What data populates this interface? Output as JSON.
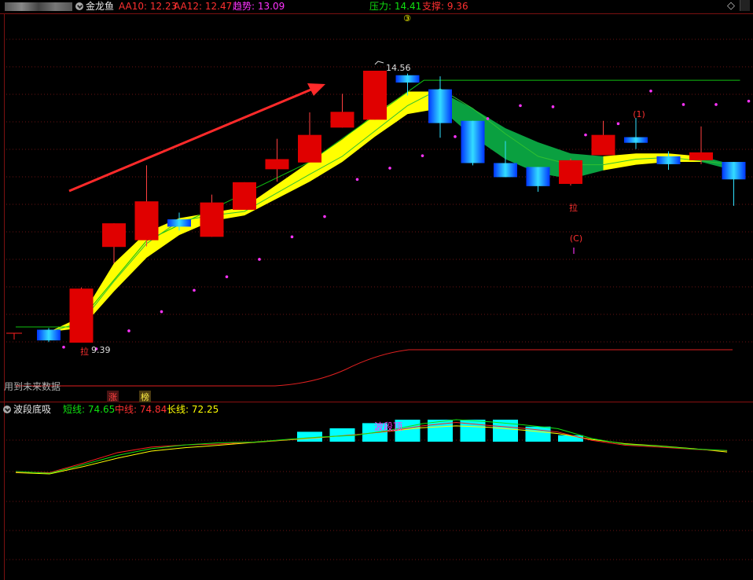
{
  "main_header": {
    "indicator_name": "金龙鱼",
    "aa10": "AA10: 12.23",
    "aa12": "AA12: 12.47",
    "trend": "趋势: 13.09",
    "pressure": "压力: 14.41",
    "support": "支撑: 9.36",
    "diamond_icon": "diamond-icon"
  },
  "main_chart": {
    "marker_top": "③",
    "high_label": "14.56",
    "low_label": "9.39",
    "pull_label_1": "拉",
    "pull_label_2": "拉",
    "wave_1": "(1)",
    "wave_c": "(C)",
    "wave_i": "I",
    "future_note": "用到未来数据",
    "tag_zhang": "涨",
    "tag_bang": "榜",
    "candles": [
      {
        "o": 10.02,
        "c": 9.83,
        "h": 10.05,
        "l": 9.8,
        "s": "blue"
      },
      {
        "o": 9.79,
        "c": 10.75,
        "h": 10.77,
        "l": 9.79,
        "s": "red"
      },
      {
        "o": 11.49,
        "c": 11.91,
        "h": 11.91,
        "l": 11.2,
        "s": "red"
      },
      {
        "o": 11.61,
        "c": 12.3,
        "h": 12.94,
        "l": 11.5,
        "s": "red"
      },
      {
        "o": 11.98,
        "c": 11.85,
        "h": 12.1,
        "l": 11.78,
        "s": "blue"
      },
      {
        "o": 11.67,
        "c": 12.28,
        "h": 12.42,
        "l": 11.67,
        "s": "red"
      },
      {
        "o": 12.15,
        "c": 12.64,
        "h": 12.64,
        "l": 12.15,
        "s": "red"
      },
      {
        "o": 12.87,
        "c": 13.05,
        "h": 13.41,
        "l": 12.65,
        "s": "red"
      },
      {
        "o": 12.99,
        "c": 13.48,
        "h": 13.88,
        "l": 12.99,
        "s": "red"
      },
      {
        "o": 13.61,
        "c": 13.89,
        "h": 14.21,
        "l": 13.61,
        "s": "red"
      },
      {
        "o": 13.75,
        "c": 14.62,
        "h": 14.62,
        "l": 13.75,
        "s": "red"
      },
      {
        "o": 14.54,
        "c": 14.41,
        "h": 14.57,
        "l": 14.18,
        "s": "blue"
      },
      {
        "o": 14.29,
        "c": 13.69,
        "h": 14.52,
        "l": 13.43,
        "s": "blue"
      },
      {
        "o": 13.73,
        "c": 12.98,
        "h": 13.73,
        "l": 12.94,
        "s": "blue"
      },
      {
        "o": 12.98,
        "c": 12.73,
        "h": 13.37,
        "l": 12.73,
        "s": "blue"
      },
      {
        "o": 12.91,
        "c": 12.57,
        "h": 12.91,
        "l": 12.47,
        "s": "blue"
      },
      {
        "o": 12.61,
        "c": 13.03,
        "h": 13.06,
        "l": 12.58,
        "s": "red"
      },
      {
        "o": 13.12,
        "c": 13.48,
        "h": 13.73,
        "l": 13.12,
        "s": "red"
      },
      {
        "o": 13.44,
        "c": 13.34,
        "h": 13.78,
        "l": 13.23,
        "s": "blue"
      },
      {
        "o": 13.1,
        "c": 12.96,
        "h": 13.19,
        "l": 12.86,
        "s": "blue"
      },
      {
        "o": 13.17,
        "c": 13.03,
        "h": 13.63,
        "l": 12.96,
        "s": "red"
      },
      {
        "o": 13.0,
        "c": 12.69,
        "h": 13.0,
        "l": 12.22,
        "s": "blue"
      }
    ],
    "fast_line": [
      9.98,
      10.15,
      10.88,
      11.55,
      11.95,
      12.05,
      12.12,
      12.45,
      12.78,
      13.1,
      13.55,
      14.0,
      14.3,
      13.95,
      13.5,
      13.1,
      12.95,
      12.95,
      13.05,
      13.08,
      13.02,
      12.95
    ],
    "band_upper": [
      9.98,
      10.25,
      11.2,
      11.75,
      12.0,
      12.1,
      12.2,
      12.6,
      13.0,
      13.4,
      13.85,
      14.25,
      14.25,
      13.95,
      13.6,
      13.35,
      13.15,
      13.1,
      13.15,
      13.15,
      13.1,
      12.95
    ],
    "band_lower": [
      9.98,
      10.05,
      10.7,
      11.3,
      11.7,
      11.95,
      12.05,
      12.35,
      12.65,
      13.0,
      13.45,
      13.85,
      13.95,
      13.45,
      13.05,
      12.8,
      12.7,
      12.85,
      12.95,
      13.0,
      13.0,
      12.85
    ],
    "band_colors": [
      "yellow",
      "yellow",
      "yellow",
      "yellow",
      "yellow",
      "yellow",
      "yellow",
      "yellow",
      "yellow",
      "yellow",
      "yellow",
      "yellow",
      "green",
      "green",
      "green",
      "green",
      "green",
      "yellow",
      "yellow",
      "yellow",
      "green",
      "green"
    ],
    "dots": [
      9.71,
      9.68,
      10.0,
      10.34,
      10.72,
      10.96,
      11.27,
      11.67,
      12.03,
      12.69,
      12.89,
      13.11,
      13.45,
      13.77,
      14.0,
      13.98,
      13.48,
      13.68,
      14.26,
      14.02,
      14.02,
      14.08
    ],
    "resistance_levels": [
      10.07,
      10.07,
      10.07,
      10.07,
      10.07,
      10.07,
      10.07,
      10.07,
      10.07,
      10.07,
      10.07,
      14.45,
      14.45,
      14.45,
      14.45,
      14.45,
      14.45,
      14.45,
      14.45,
      14.45,
      14.45,
      14.45
    ],
    "lower_curve": [
      0.0,
      0.0,
      0.0,
      0.0,
      0.0,
      0.0,
      0.0,
      0.0,
      0.06,
      0.17,
      0.35,
      0.72,
      1.0,
      1.0,
      1.0,
      1.0,
      1.0,
      1.0,
      1.0,
      1.0,
      1.0,
      1.0
    ]
  },
  "sub_header": {
    "indicator_name": "波段底吸",
    "short_line": "短线: 74.65",
    "mid_line": "中线: 74.84",
    "long_line": "长线: 72.25"
  },
  "sub_chart": {
    "top_label": "波段顶",
    "short": [
      60.8,
      60.2,
      63.0,
      66.0,
      68.2,
      69.4,
      70.1,
      70.3,
      71.2,
      72.0,
      72.5,
      74.1,
      76.3,
      77.6,
      76.9,
      75.9,
      74.7,
      71.5,
      69.6,
      69.0,
      68.1,
      67.6
    ],
    "mid": [
      60.6,
      60.4,
      63.5,
      66.9,
      68.7,
      69.4,
      69.7,
      70.3,
      71.1,
      71.9,
      72.7,
      73.8,
      75.6,
      76.7,
      75.7,
      74.8,
      73.6,
      70.9,
      69.3,
      68.7,
      68.0,
      67.5
    ],
    "long": [
      60.4,
      60.0,
      62.4,
      65.1,
      67.4,
      68.5,
      69.3,
      70.2,
      71.0,
      71.8,
      72.7,
      73.8,
      75.0,
      75.6,
      75.1,
      74.2,
      73.1,
      71.2,
      69.8,
      69.1,
      68.2,
      67.1
    ],
    "top_bars": [
      0,
      0,
      0,
      0,
      0,
      0,
      0,
      0,
      0.3,
      0.5,
      0.8,
      1.0,
      1.0,
      1.0,
      1.0,
      0.6,
      0.1,
      0,
      0,
      0,
      0,
      0
    ]
  },
  "colors": {
    "red": "#ff2020",
    "magenta": "#ff33ff",
    "green": "#10e010",
    "yellow": "#ffff00",
    "cyan": "#00ffff"
  }
}
